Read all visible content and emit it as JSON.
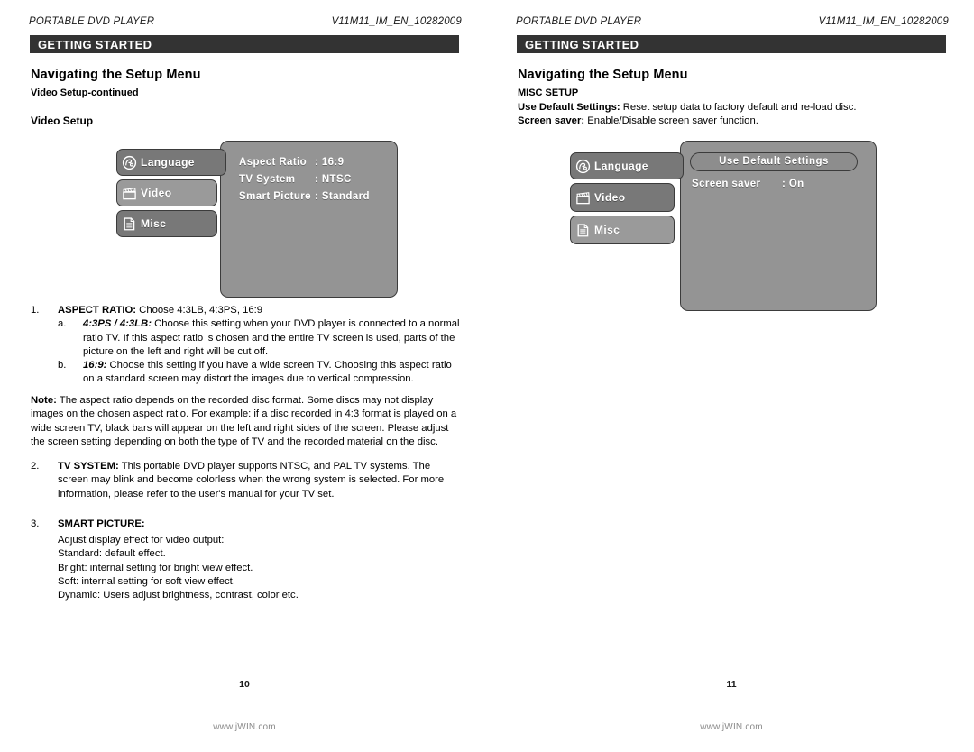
{
  "document": {
    "running_head_left": "PORTABLE DVD PLAYER",
    "running_head_right": "V11M11_IM_EN_10282009",
    "section_bar_label": "GETTING STARTED",
    "site_footer": "www.jWIN.com"
  },
  "left_page": {
    "page_number": "10",
    "heading": "Navigating the Setup Menu",
    "subheading": "Video Setup-continued",
    "subheading2": "Video Setup",
    "osd": {
      "tabs": [
        {
          "label": "Language",
          "icon": "globe-disc-icon",
          "selected": false
        },
        {
          "label": "Video",
          "icon": "clapperboard-icon",
          "selected": true
        },
        {
          "label": "Misc",
          "icon": "document-icon",
          "selected": false
        }
      ],
      "rows": [
        {
          "key": "Aspect Ratio",
          "value": ": 16:9"
        },
        {
          "key": "TV System",
          "value": ": NTSC"
        },
        {
          "key": "Smart Picture",
          "value": ": Standard"
        }
      ]
    },
    "item1": {
      "marker": "1.",
      "bold": "ASPECT RATIO:",
      "text": " Choose 4:3LB, 4:3PS, 16:9"
    },
    "item1a": {
      "marker": "a.",
      "italic": "4:3PS / 4:3LB:",
      "text": " Choose this setting when your DVD player is connected to a normal ratio TV. If this aspect ratio is chosen and the entire TV screen is used, parts of the picture on the left and right will be cut off."
    },
    "item1b": {
      "marker": "b.",
      "italic": "16:9:",
      "text": " Choose this setting if you have a wide screen TV. Choosing this aspect ratio on a standard screen may distort the images due to vertical compression."
    },
    "note": {
      "bold": "Note:",
      "text": " The aspect ratio depends on the recorded disc format. Some discs may not display images on the chosen aspect ratio. For example: if a disc recorded in 4:3 format is played on a wide screen TV, black bars will appear on the left and right sides of the screen. Please adjust the screen setting depending on both the type of TV and the recorded material on the disc."
    },
    "item2": {
      "marker": "2.",
      "bold": "TV SYSTEM:",
      "text": " This portable DVD player supports NTSC, and PAL TV systems. The screen may blink and become colorless when the wrong system is selected. For more information, please refer to the user's manual for your TV set."
    },
    "item3": {
      "marker": "3.",
      "bold": "SMART PICTURE:"
    },
    "item3_lines": [
      "Adjust display effect for video output:",
      "Standard: default effect.",
      "Bright: internal setting for bright view effect.",
      "Soft: internal setting for soft view effect.",
      "Dynamic: Users adjust brightness, contrast, color etc."
    ]
  },
  "right_page": {
    "page_number": "11",
    "heading": "Navigating the Setup Menu",
    "subheading": "MISC SETUP",
    "line1": {
      "bold": "Use Default Settings:",
      "text": " Reset setup data to factory default and re-load disc."
    },
    "line2": {
      "bold": "Screen saver:",
      "text": " Enable/Disable screen saver function."
    },
    "osd": {
      "tabs": [
        {
          "label": "Language",
          "icon": "globe-disc-icon",
          "selected": false
        },
        {
          "label": "Video",
          "icon": "clapperboard-icon",
          "selected": false
        },
        {
          "label": "Misc",
          "icon": "document-icon",
          "selected": true
        }
      ],
      "highlight_button": "Use Default Settings",
      "row": {
        "key": "Screen saver",
        "value": ": On"
      }
    }
  },
  "colors": {
    "section_bar": "#333333",
    "osd_panel": "#949494",
    "osd_tab": "#787878",
    "osd_tab_selected": "#9a9a9a",
    "osd_border": "#3b3b3b",
    "footer_text": "#8a8a8a"
  }
}
